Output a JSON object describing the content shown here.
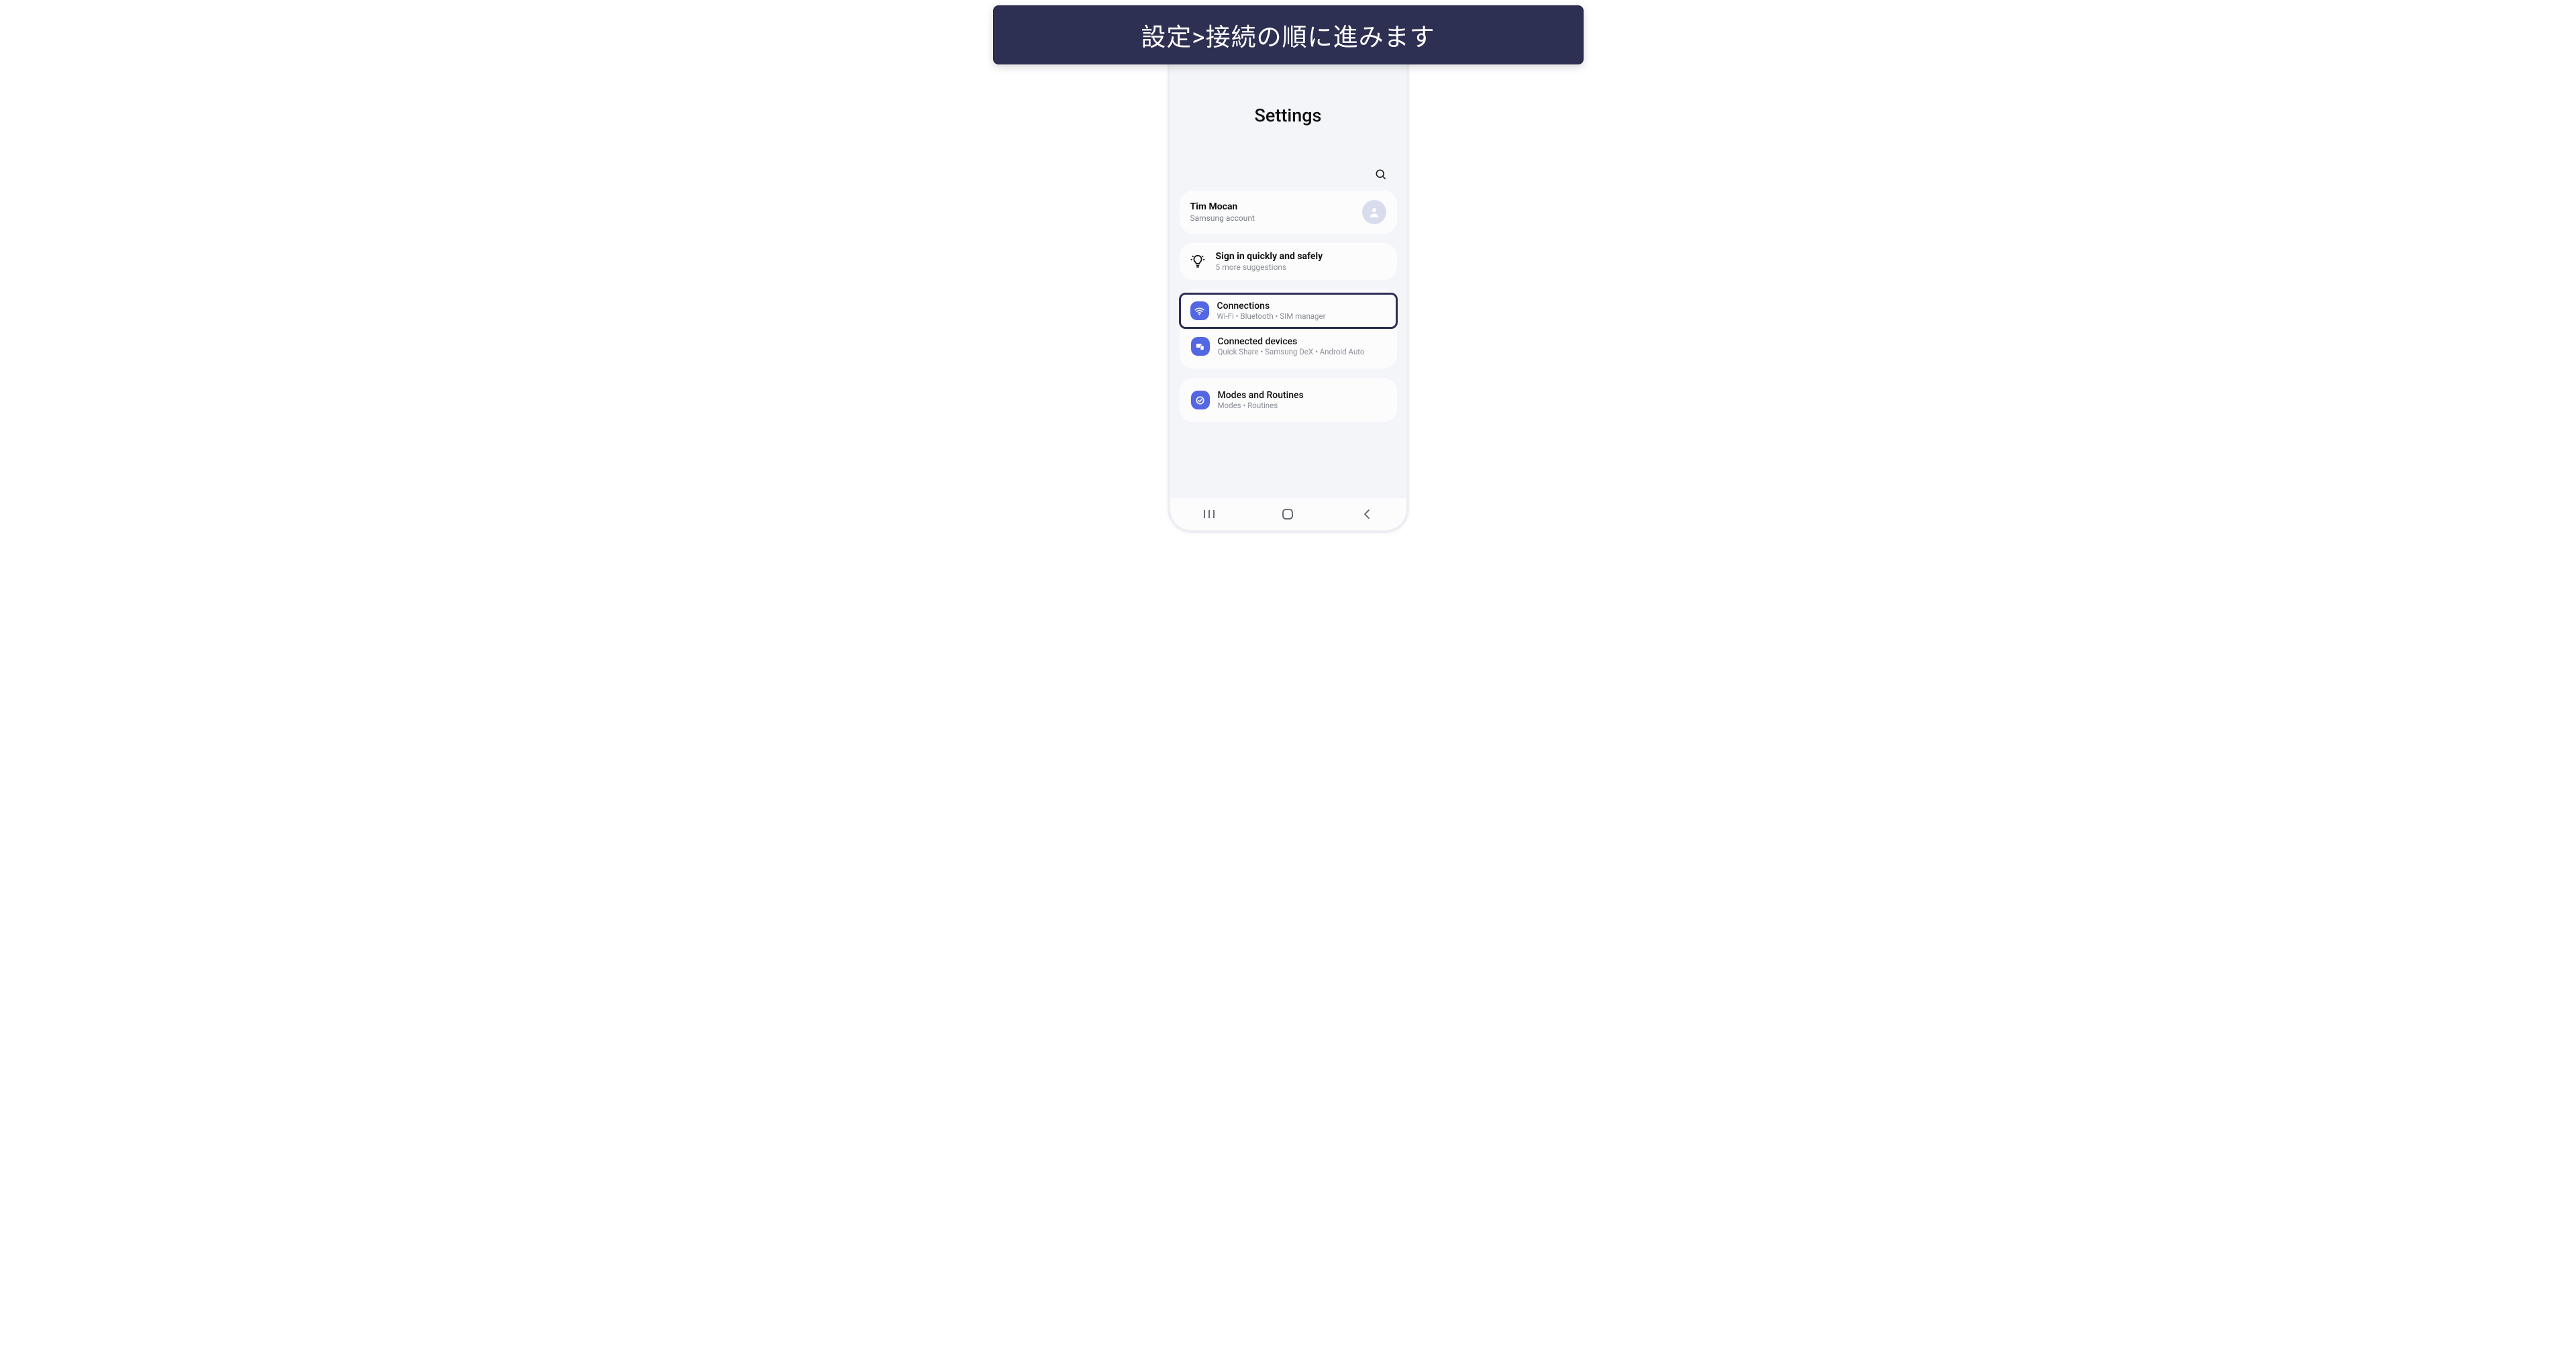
{
  "instruction_banner": "設定>接続の順に進みます",
  "screen": {
    "title": "Settings",
    "search_placeholder": "Search"
  },
  "account": {
    "name": "Tim Mocan",
    "subtitle": "Samsung account"
  },
  "suggestion": {
    "title": "Sign in quickly and safely",
    "subtitle": "5 more suggestions"
  },
  "group1": {
    "items": [
      {
        "title": "Connections",
        "subtitle": "Wi-Fi  •  Bluetooth  •  SIM manager",
        "highlighted": true
      },
      {
        "title": "Connected devices",
        "subtitle": "Quick Share  •  Samsung DeX  •  Android Auto",
        "highlighted": false
      }
    ]
  },
  "group2": {
    "items": [
      {
        "title": "Modes and Routines",
        "subtitle": "Modes  •  Routines",
        "highlighted": false
      }
    ]
  }
}
